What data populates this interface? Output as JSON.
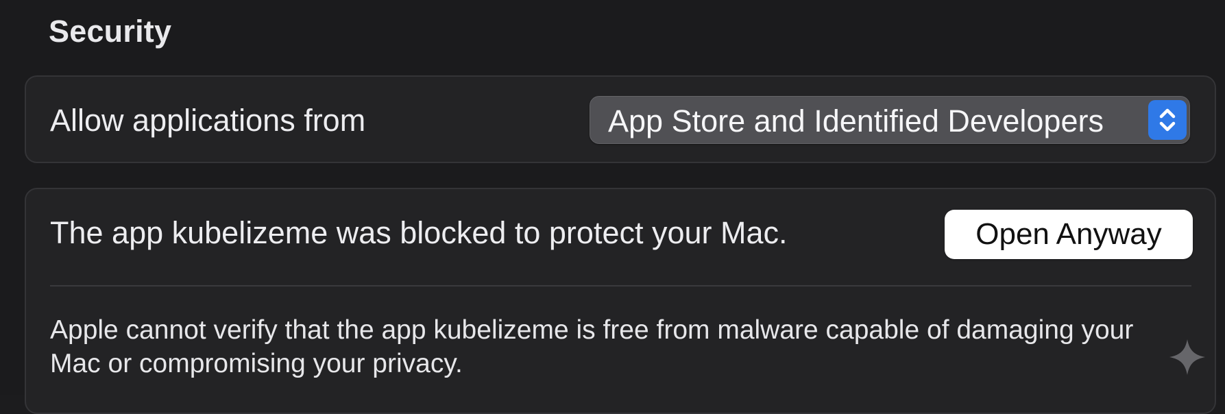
{
  "section": {
    "title": "Security"
  },
  "allow_applications": {
    "label": "Allow applications from",
    "selected_value": "App Store and Identified Developers",
    "arrows_icon": "up-down-chevron-icon",
    "accent_color": "#2f79e7"
  },
  "blocked_app": {
    "message": "The app kubelizeme was blocked to protect your Mac.",
    "open_button_label": "Open Anyway",
    "description": "Apple cannot verify that the app kubelizeme is free from malware capable of damaging your Mac or compromising your privacy."
  },
  "decorations": {
    "corner_icon": "sparkle-icon"
  }
}
